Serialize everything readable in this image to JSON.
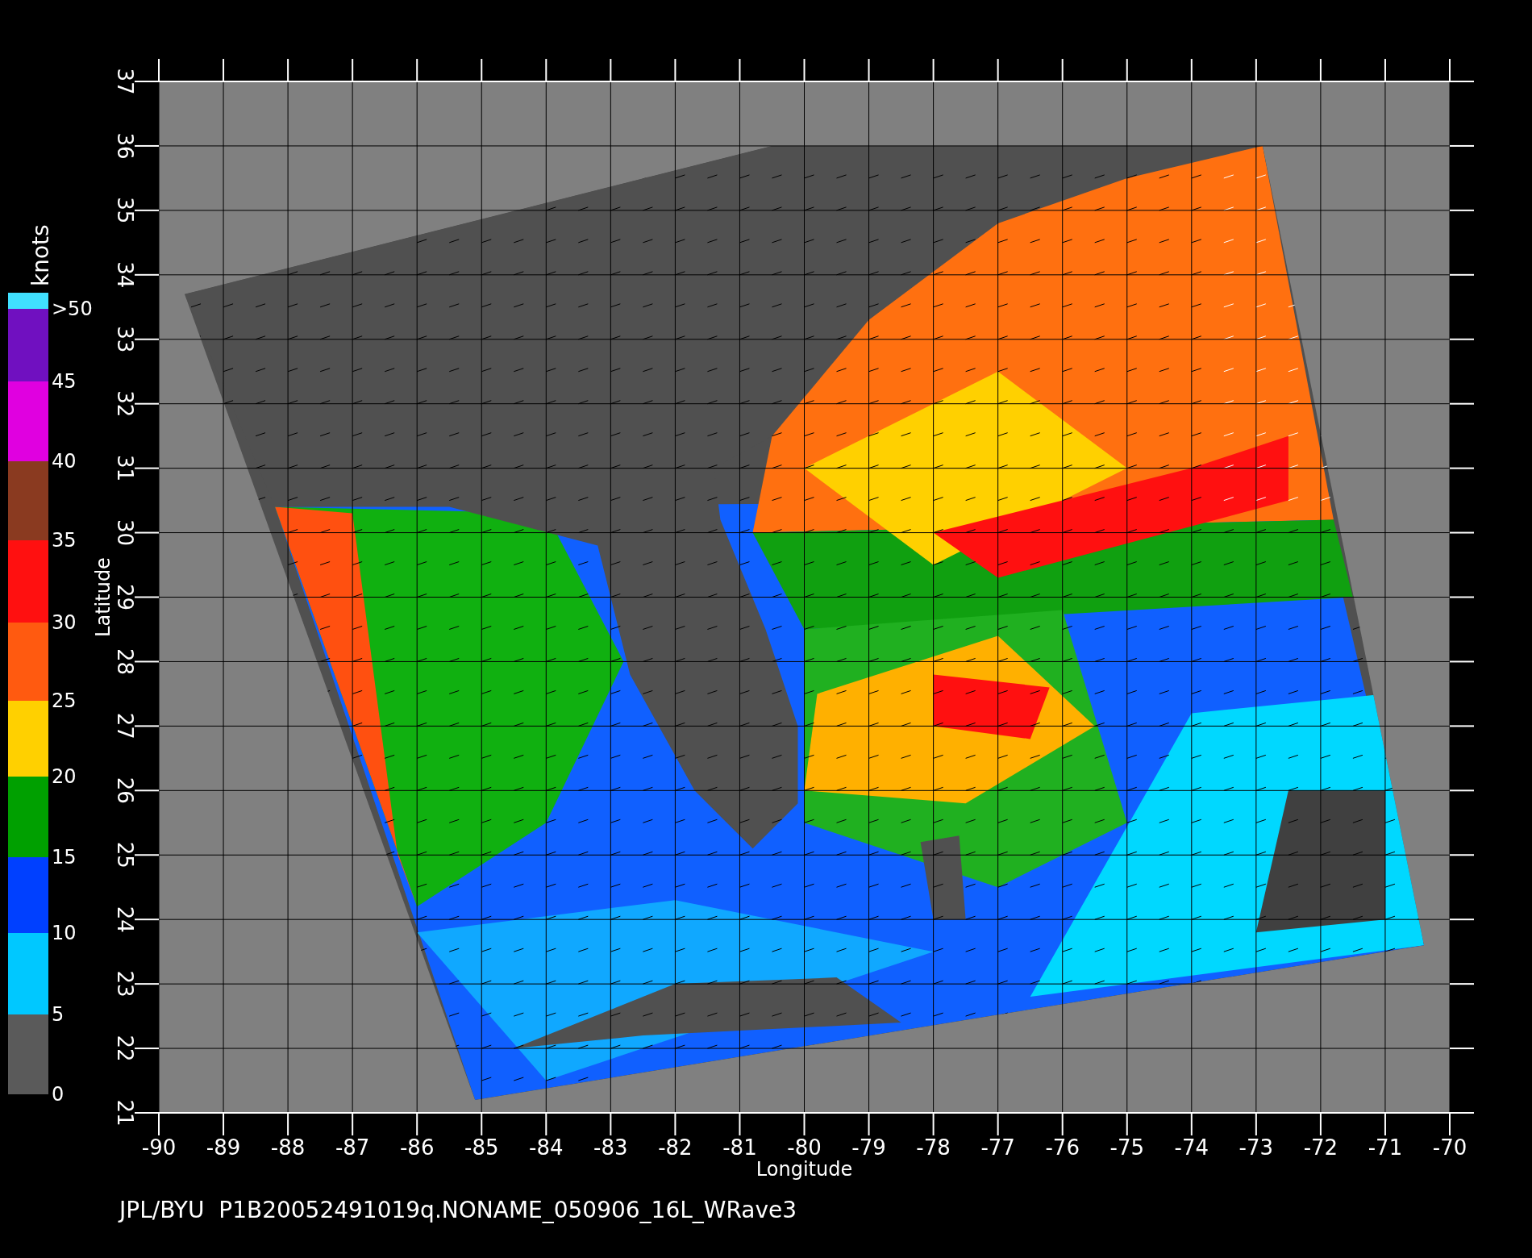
{
  "plot": {
    "xlabel": "Longitude",
    "ylabel": "Latitude",
    "xticks": [
      "-90",
      "-89",
      "-88",
      "-87",
      "-86",
      "-85",
      "-84",
      "-83",
      "-82",
      "-81",
      "-80",
      "-79",
      "-78",
      "-77",
      "-76",
      "-75",
      "-74",
      "-73",
      "-72",
      "-71",
      "-70"
    ],
    "yticks": [
      "21",
      "22",
      "23",
      "24",
      "25",
      "26",
      "27",
      "28",
      "29",
      "30",
      "31",
      "32",
      "33",
      "34",
      "35",
      "36",
      "37"
    ]
  },
  "colorbar": {
    "unit": "knots",
    "segments": [
      {
        "label": ">50",
        "color": "#40e0ff"
      },
      {
        "label": "45",
        "color": "#7010c0"
      },
      {
        "label": "40",
        "color": "#e000e0"
      },
      {
        "label": "35",
        "color": "#8a3a20"
      },
      {
        "label": "30",
        "color": "#ff1010"
      },
      {
        "label": "25",
        "color": "#ff5a10"
      },
      {
        "label": "20",
        "color": "#ffd000"
      },
      {
        "label": "15",
        "color": "#00a000"
      },
      {
        "label": "10",
        "color": "#0040ff"
      },
      {
        "label": "5",
        "color": "#00c8ff"
      },
      {
        "label": "0",
        "color": "#5a5a5a"
      }
    ]
  },
  "caption": "JPL/BYU  P1B20052491019q.NONAME_050906_16L_WRave3"
}
